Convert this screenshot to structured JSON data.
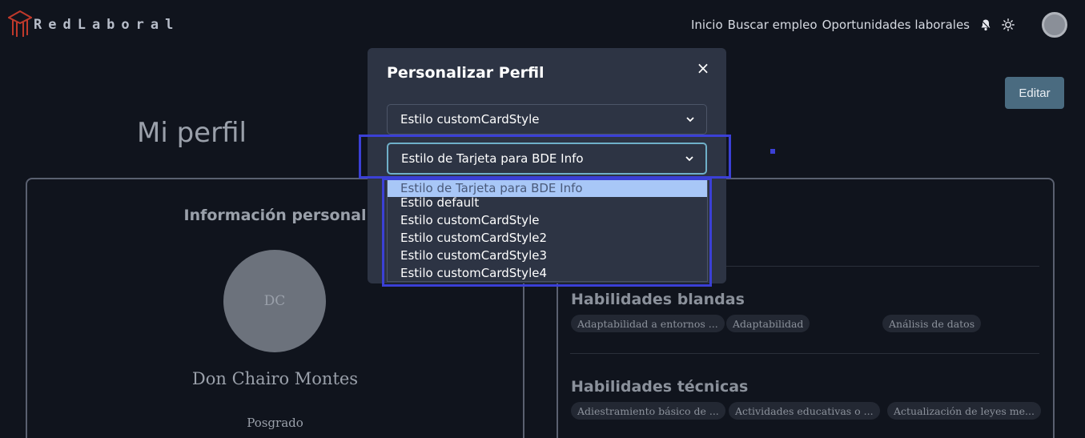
{
  "navbar": {
    "brand": "RedLaboral",
    "links": [
      "Inicio",
      "Buscar empleo",
      "Oportunidades laborales"
    ]
  },
  "page": {
    "title": "Mi perfil",
    "edit_button": "Editar"
  },
  "profile": {
    "section_title": "Información personal",
    "initials": "DC",
    "name": "Don Chairo Montes",
    "level": "Posgrado"
  },
  "skills": {
    "soft_title": "Habilidades blandas",
    "soft": [
      "Adaptabilidad a entornos ...",
      "Adaptabilidad",
      "Análisis de datos"
    ],
    "tech_title": "Habilidades técnicas",
    "tech": [
      "Adiestramiento básico de ...",
      "Actividades educativas o ...",
      "Actualización de leyes me..."
    ]
  },
  "modal": {
    "title": "Personalizar Perfil",
    "close_symbol": "×",
    "select1_value": "Estilo customCardStyle",
    "select2_value": "Estilo de Tarjeta para BDE Info",
    "options": [
      "Estilo de Tarjeta para BDE Info",
      "Estilo default",
      "Estilo customCardStyle",
      "Estilo customCardStyle2",
      "Estilo customCardStyle3",
      "Estilo customCardStyle4"
    ]
  },
  "colors": {
    "background": "#10141d",
    "modal": "#2d3444",
    "highlight": "#3b40d6",
    "option_active": "#a8c7f7",
    "edit_button": "#4a6b80"
  },
  "icons": [
    "graduation-cap-logo-icon",
    "bell-icon",
    "sun-icon",
    "chevron-down-icon",
    "close-icon"
  ]
}
